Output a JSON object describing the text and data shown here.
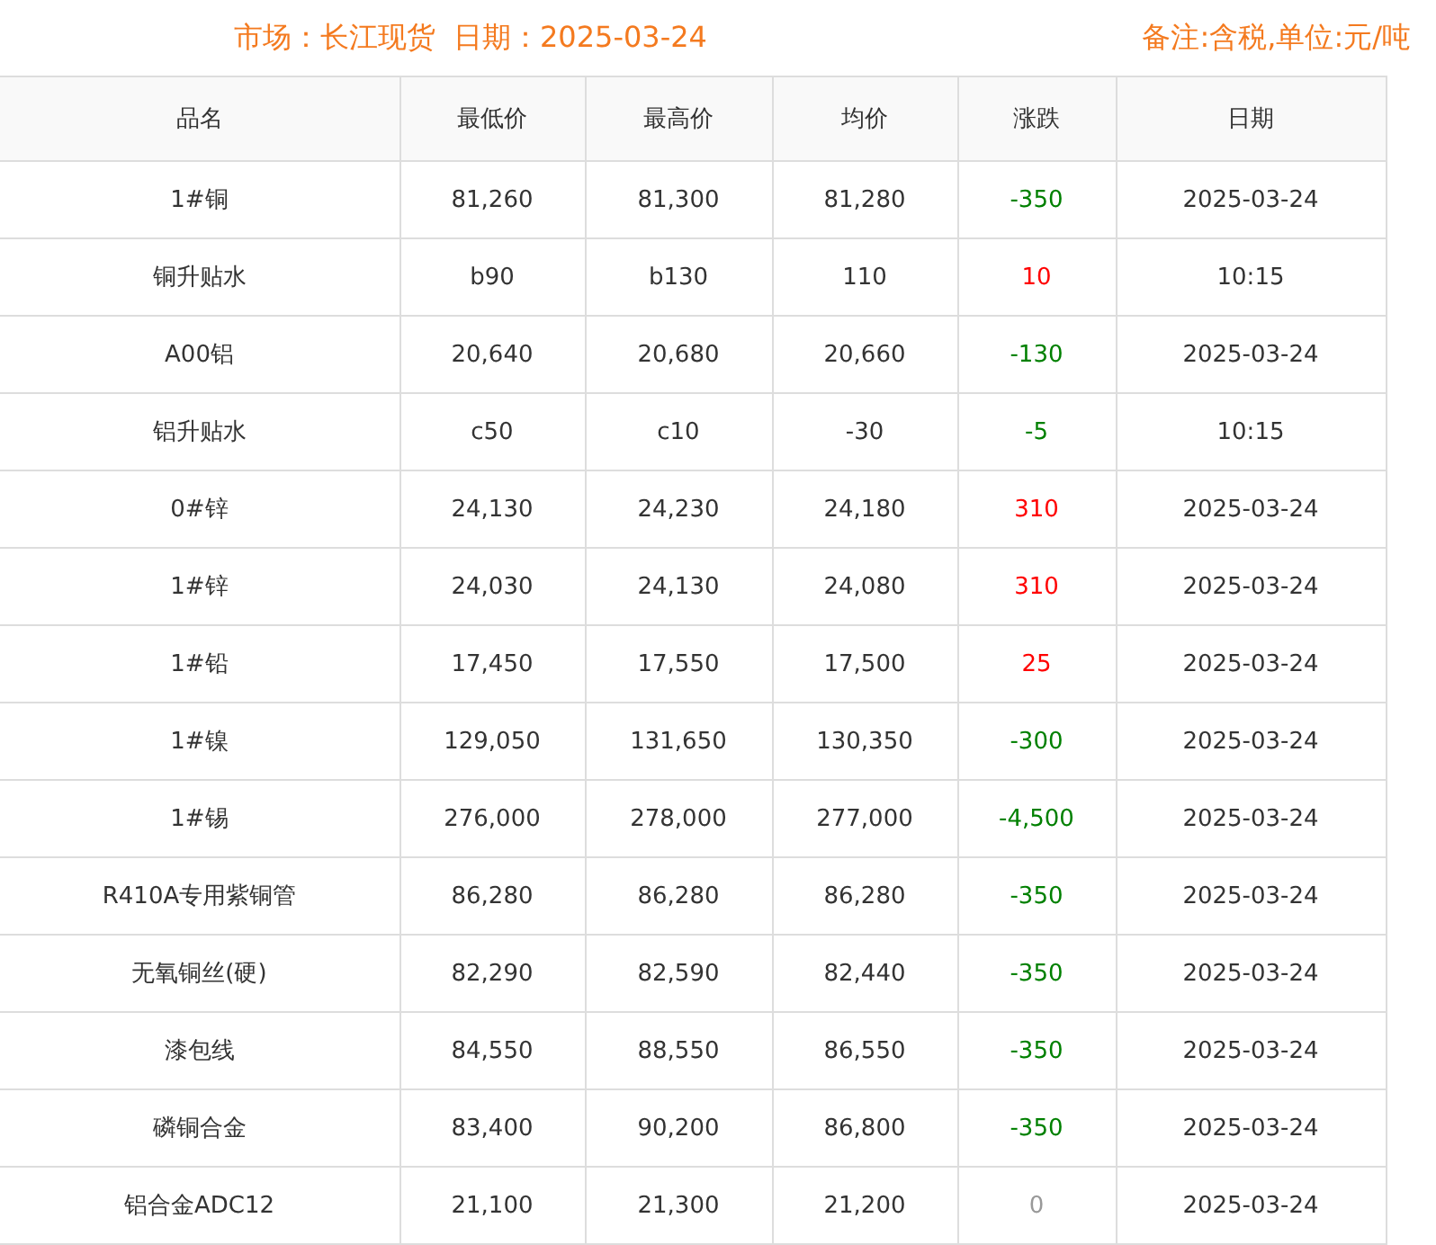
{
  "header": {
    "market": "市场：长江现货",
    "date": "日期：2025-03-24",
    "note": "备注:含税,单位:元/吨"
  },
  "table": {
    "columns": [
      "品名",
      "最低价",
      "最高价",
      "均价",
      "涨跌",
      "日期"
    ],
    "rows": [
      {
        "name": "1#铜",
        "low": "81,260",
        "high": "81,300",
        "avg": "81,280",
        "change": "-350",
        "color": "#008000",
        "date": "2025-03-24"
      },
      {
        "name": "铜升贴水",
        "low": "b90",
        "high": "b130",
        "avg": "110",
        "change": "10",
        "color": "#ff0000",
        "date": "10:15"
      },
      {
        "name": "A00铝",
        "low": "20,640",
        "high": "20,680",
        "avg": "20,660",
        "change": "-130",
        "color": "#008000",
        "date": "2025-03-24"
      },
      {
        "name": "铝升贴水",
        "low": "c50",
        "high": "c10",
        "avg": "-30",
        "change": "-5",
        "color": "#008000",
        "date": "10:15"
      },
      {
        "name": "0#锌",
        "low": "24,130",
        "high": "24,230",
        "avg": "24,180",
        "change": "310",
        "color": "#ff0000",
        "date": "2025-03-24"
      },
      {
        "name": "1#锌",
        "low": "24,030",
        "high": "24,130",
        "avg": "24,080",
        "change": "310",
        "color": "#ff0000",
        "date": "2025-03-24"
      },
      {
        "name": "1#铅",
        "low": "17,450",
        "high": "17,550",
        "avg": "17,500",
        "change": "25",
        "color": "#ff0000",
        "date": "2025-03-24"
      },
      {
        "name": "1#镍",
        "low": "129,050",
        "high": "131,650",
        "avg": "130,350",
        "change": "-300",
        "color": "#008000",
        "date": "2025-03-24"
      },
      {
        "name": "1#锡",
        "low": "276,000",
        "high": "278,000",
        "avg": "277,000",
        "change": "-4,500",
        "color": "#008000",
        "date": "2025-03-24"
      },
      {
        "name": "R410A专用紫铜管",
        "low": "86,280",
        "high": "86,280",
        "avg": "86,280",
        "change": "-350",
        "color": "#008000",
        "date": "2025-03-24"
      },
      {
        "name": "无氧铜丝(硬)",
        "low": "82,290",
        "high": "82,590",
        "avg": "82,440",
        "change": "-350",
        "color": "#008000",
        "date": "2025-03-24"
      },
      {
        "name": "漆包线",
        "low": "84,550",
        "high": "88,550",
        "avg": "86,550",
        "change": "-350",
        "color": "#008000",
        "date": "2025-03-24"
      },
      {
        "name": "磷铜合金",
        "low": "83,400",
        "high": "90,200",
        "avg": "86,800",
        "change": "-350",
        "color": "#008000",
        "date": "2025-03-24"
      },
      {
        "name": "铝合金ADC12",
        "low": "21,100",
        "high": "21,300",
        "avg": "21,200",
        "change": "0",
        "color": "#999999",
        "date": "2025-03-24"
      }
    ]
  }
}
